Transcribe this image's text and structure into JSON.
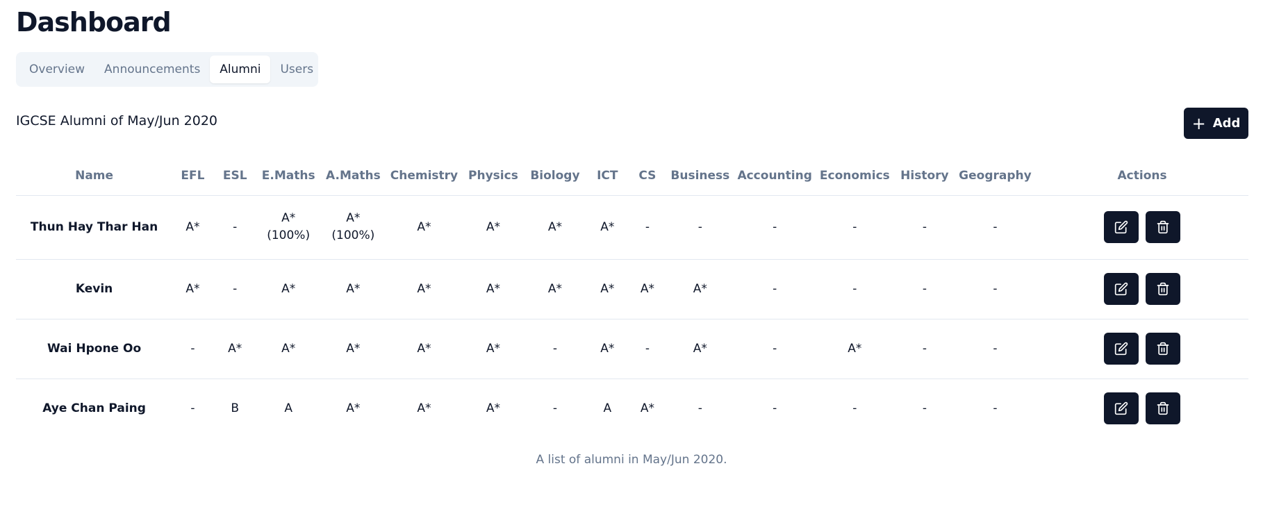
{
  "page": {
    "title": "Dashboard"
  },
  "tabs": [
    {
      "label": "Overview",
      "active": false
    },
    {
      "label": "Announcements",
      "active": false
    },
    {
      "label": "Alumni",
      "active": true
    },
    {
      "label": "Users",
      "active": false
    }
  ],
  "section": {
    "title": "IGCSE Alumni of May/Jun 2020"
  },
  "add_button": {
    "label": "Add",
    "icon": "plus-icon"
  },
  "table": {
    "columns": [
      "Name",
      "EFL",
      "ESL",
      "E.Maths",
      "A.Maths",
      "Chemistry",
      "Physics",
      "Biology",
      "ICT",
      "CS",
      "Business",
      "Accounting",
      "Economics",
      "History",
      "Geography",
      "Actions"
    ],
    "rows": [
      {
        "name": "Thun Hay Thar Han",
        "grades": [
          "A*",
          "-",
          "A*\n(100%)",
          "A*\n(100%)",
          "A*",
          "A*",
          "A*",
          "A*",
          "-",
          "-",
          "-",
          "-",
          "-",
          "-"
        ]
      },
      {
        "name": "Kevin",
        "grades": [
          "A*",
          "-",
          "A*",
          "A*",
          "A*",
          "A*",
          "A*",
          "A*",
          "A*",
          "A*",
          "-",
          "-",
          "-",
          "-"
        ]
      },
      {
        "name": "Wai Hpone Oo",
        "grades": [
          "-",
          "A*",
          "A*",
          "A*",
          "A*",
          "A*",
          "-",
          "A*",
          "-",
          "A*",
          "-",
          "A*",
          "-",
          "-"
        ]
      },
      {
        "name": "Aye Chan Paing",
        "grades": [
          "-",
          "B",
          "A",
          "A*",
          "A*",
          "A*",
          "-",
          "A",
          "A*",
          "-",
          "-",
          "-",
          "-",
          "-"
        ]
      }
    ],
    "row_action_icons": [
      "edit-icon",
      "trash-icon"
    ],
    "caption": "A list of alumni in May/Jun 2020."
  },
  "colors": {
    "primary": "#0f172a",
    "muted": "#64748b",
    "tabs_bg": "#f1f5f9",
    "border": "#e2e8f0"
  }
}
